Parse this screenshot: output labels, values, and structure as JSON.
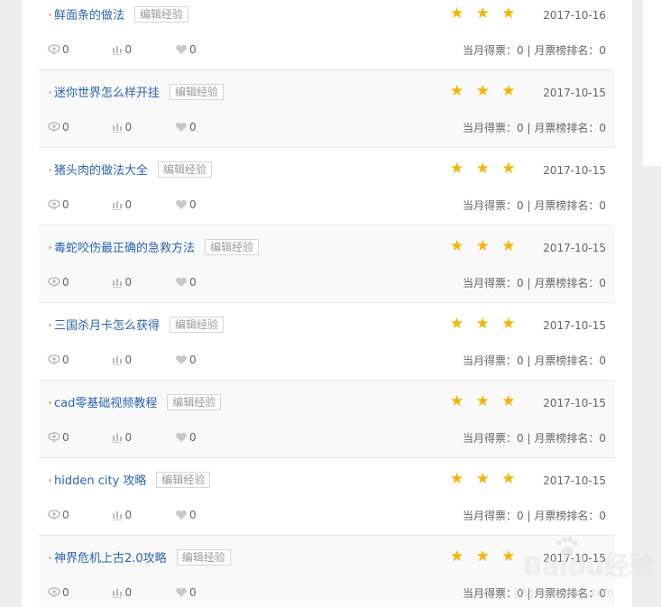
{
  "items": [
    {
      "title": "鲜面条的做法",
      "tag": "编辑经验",
      "stars": "★ ★ ★",
      "date": "2017-10-16",
      "views": "0",
      "votes_count": "0",
      "likes": "0",
      "monthly": "当月得票：0 | 月票榜排名：0"
    },
    {
      "title": "迷你世界怎么样开挂",
      "tag": "编辑经验",
      "stars": "★ ★ ★",
      "date": "2017-10-15",
      "views": "0",
      "votes_count": "0",
      "likes": "0",
      "monthly": "当月得票：0 | 月票榜排名：0"
    },
    {
      "title": "猪头肉的做法大全",
      "tag": "编辑经验",
      "stars": "★ ★ ★",
      "date": "2017-10-15",
      "views": "0",
      "votes_count": "0",
      "likes": "0",
      "monthly": "当月得票：0 | 月票榜排名：0"
    },
    {
      "title": "毒蛇咬伤最正确的急救方法",
      "tag": "编辑经验",
      "stars": "★ ★ ★",
      "date": "2017-10-15",
      "views": "0",
      "votes_count": "0",
      "likes": "0",
      "monthly": "当月得票：0 | 月票榜排名：0"
    },
    {
      "title": "三国杀月卡怎么获得",
      "tag": "编辑经验",
      "stars": "★ ★ ★",
      "date": "2017-10-15",
      "views": "0",
      "votes_count": "0",
      "likes": "0",
      "monthly": "当月得票：0 | 月票榜排名：0"
    },
    {
      "title": "cad零基础视频教程",
      "tag": "编辑经验",
      "stars": "★ ★ ★",
      "date": "2017-10-15",
      "views": "0",
      "votes_count": "0",
      "likes": "0",
      "monthly": "当月得票：0 | 月票榜排名：0"
    },
    {
      "title": "hidden city 攻略",
      "tag": "编辑经验",
      "stars": "★ ★ ★",
      "date": "2017-10-15",
      "views": "0",
      "votes_count": "0",
      "likes": "0",
      "monthly": "当月得票：0 | 月票榜排名：0"
    },
    {
      "title": "神界危机上古2.0攻略",
      "tag": "编辑经验",
      "stars": "★ ★ ★",
      "date": "2017-10-15",
      "views": "0",
      "votes_count": "0",
      "likes": "0",
      "monthly": "当月得票：0 | 月票榜排名：0"
    }
  ],
  "watermark": {
    "brand": "Baidu经验",
    "url": "jingyan.baidu.com"
  },
  "colors": {
    "link": "#2d64b3",
    "star": "#f5b400",
    "meta": "#666666",
    "tag_border": "#d5d5d5"
  }
}
